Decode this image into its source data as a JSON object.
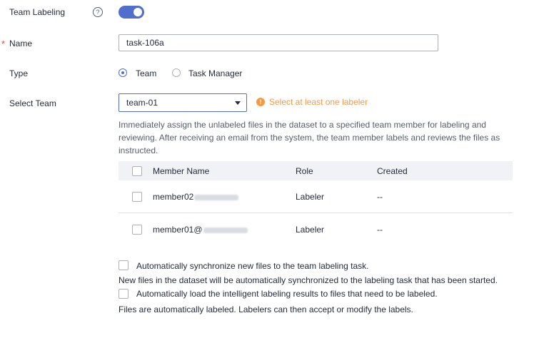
{
  "form": {
    "team_labeling_label": "Team Labeling",
    "team_labeling_enabled": true,
    "name_required_mark": "*",
    "name_label": "Name",
    "name_value": "task-106a",
    "type_label": "Type",
    "type_options": [
      "Team",
      "Task Manager"
    ],
    "type_selected": "Team",
    "select_team_label": "Select Team",
    "select_team_value": "team-01",
    "warning": "Select at least one labeler",
    "description": "Immediately assign the unlabeled files in the dataset to a specified team member for labeling and reviewing. After receiving an email from the system, the team member labels and reviews the files as instructed."
  },
  "table": {
    "columns": [
      "Member Name",
      "Role",
      "Created"
    ],
    "rows": [
      {
        "name_prefix": "member02",
        "role": "Labeler",
        "created": "--"
      },
      {
        "name_prefix": "member01@",
        "role": "Labeler",
        "created": "--"
      }
    ]
  },
  "options": {
    "sync_label": "Automatically synchronize new files to the team labeling task.",
    "sync_note": "New files in the dataset will be automatically synchronized to the labeling task that has been started.",
    "auto_load_label": "Automatically load the intelligent labeling results to files that need to be labeled.",
    "auto_load_note": "Files are automatically labeled. Labelers can then accept or modify the labels."
  },
  "colors": {
    "accent": "#526ecc",
    "warning": "#fa9841",
    "required": "#f5454a"
  }
}
